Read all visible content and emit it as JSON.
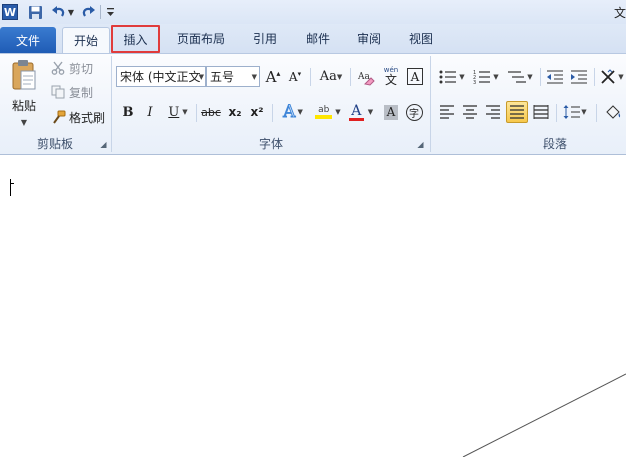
{
  "titlebar": {
    "app_logo": "W",
    "window_title": "文",
    "icons": [
      "word-logo-icon",
      "save-icon",
      "undo-icon",
      "redo-icon",
      "customize-quick-access-icon"
    ]
  },
  "tabs": {
    "file": "文件",
    "home": "开始",
    "insert": "插入",
    "page_layout": "页面布局",
    "references": "引用",
    "mailings": "邮件",
    "review": "审阅",
    "view": "视图"
  },
  "clipboard": {
    "paste": "粘贴",
    "cut": "剪切",
    "copy": "复制",
    "format_painter": "格式刷",
    "group_label": "剪贴板"
  },
  "font": {
    "font_name": "宋体 (中文正文",
    "font_size": "五号",
    "change_case": "Aa",
    "bold": "B",
    "italic": "I",
    "underline": "U",
    "strikethrough": "abc",
    "subscript": "x₂",
    "superscript": "x²",
    "text_effect": "A",
    "highlight": "ab",
    "font_color": "A",
    "char_shading": "A",
    "enclose_char": "字",
    "phonetic_guide": "wén",
    "phonetic_guide_char": "文",
    "group_label": "字体"
  },
  "paragraph": {
    "group_label": "段落"
  },
  "colors": {
    "accent": "#1f5cb5",
    "highlight_box": "#e03b3b",
    "highlight_yellow": "#ffe600",
    "font_red": "#e02020"
  }
}
